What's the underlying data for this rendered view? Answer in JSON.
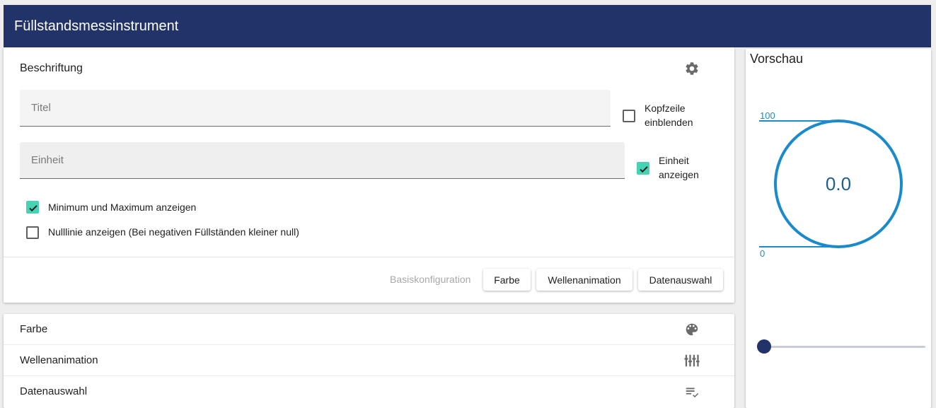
{
  "header": {
    "title": "Füllstandsmessinstrument"
  },
  "labels_section": {
    "title": "Beschriftung",
    "titel_field": {
      "placeholder": "Titel",
      "value": ""
    },
    "einheit_field": {
      "placeholder": "Einheit",
      "value": ""
    },
    "kopfzeile": {
      "line1": "Kopfzeile",
      "line2": "einblenden",
      "checked": false
    },
    "einheit_anzeigen": {
      "line1": "Einheit",
      "line2": "anzeigen",
      "checked": true
    },
    "min_max": {
      "label": "Minimum und Maximum anzeigen",
      "checked": true
    },
    "nulllinie": {
      "label": "Nulllinie anzeigen (Bei negativen Füllständen kleiner null)",
      "checked": false
    }
  },
  "footer_buttons": {
    "basis": "Basiskonfiguration",
    "farbe": "Farbe",
    "wellen": "Wellenanimation",
    "daten": "Datenauswahl"
  },
  "list": [
    {
      "label": "Farbe",
      "icon": "palette-icon"
    },
    {
      "label": "Wellenanimation",
      "icon": "equalizer-icon"
    },
    {
      "label": "Datenauswahl",
      "icon": "playlist-check-icon"
    }
  ],
  "preview": {
    "title": "Vorschau",
    "value": "0.0",
    "max_label": "100",
    "min_label": "0",
    "slider_level": 0,
    "accent": "#1a8acb"
  },
  "colors": {
    "header": "#213368",
    "check": "#45d3b3",
    "gauge": "#1a8acb"
  }
}
